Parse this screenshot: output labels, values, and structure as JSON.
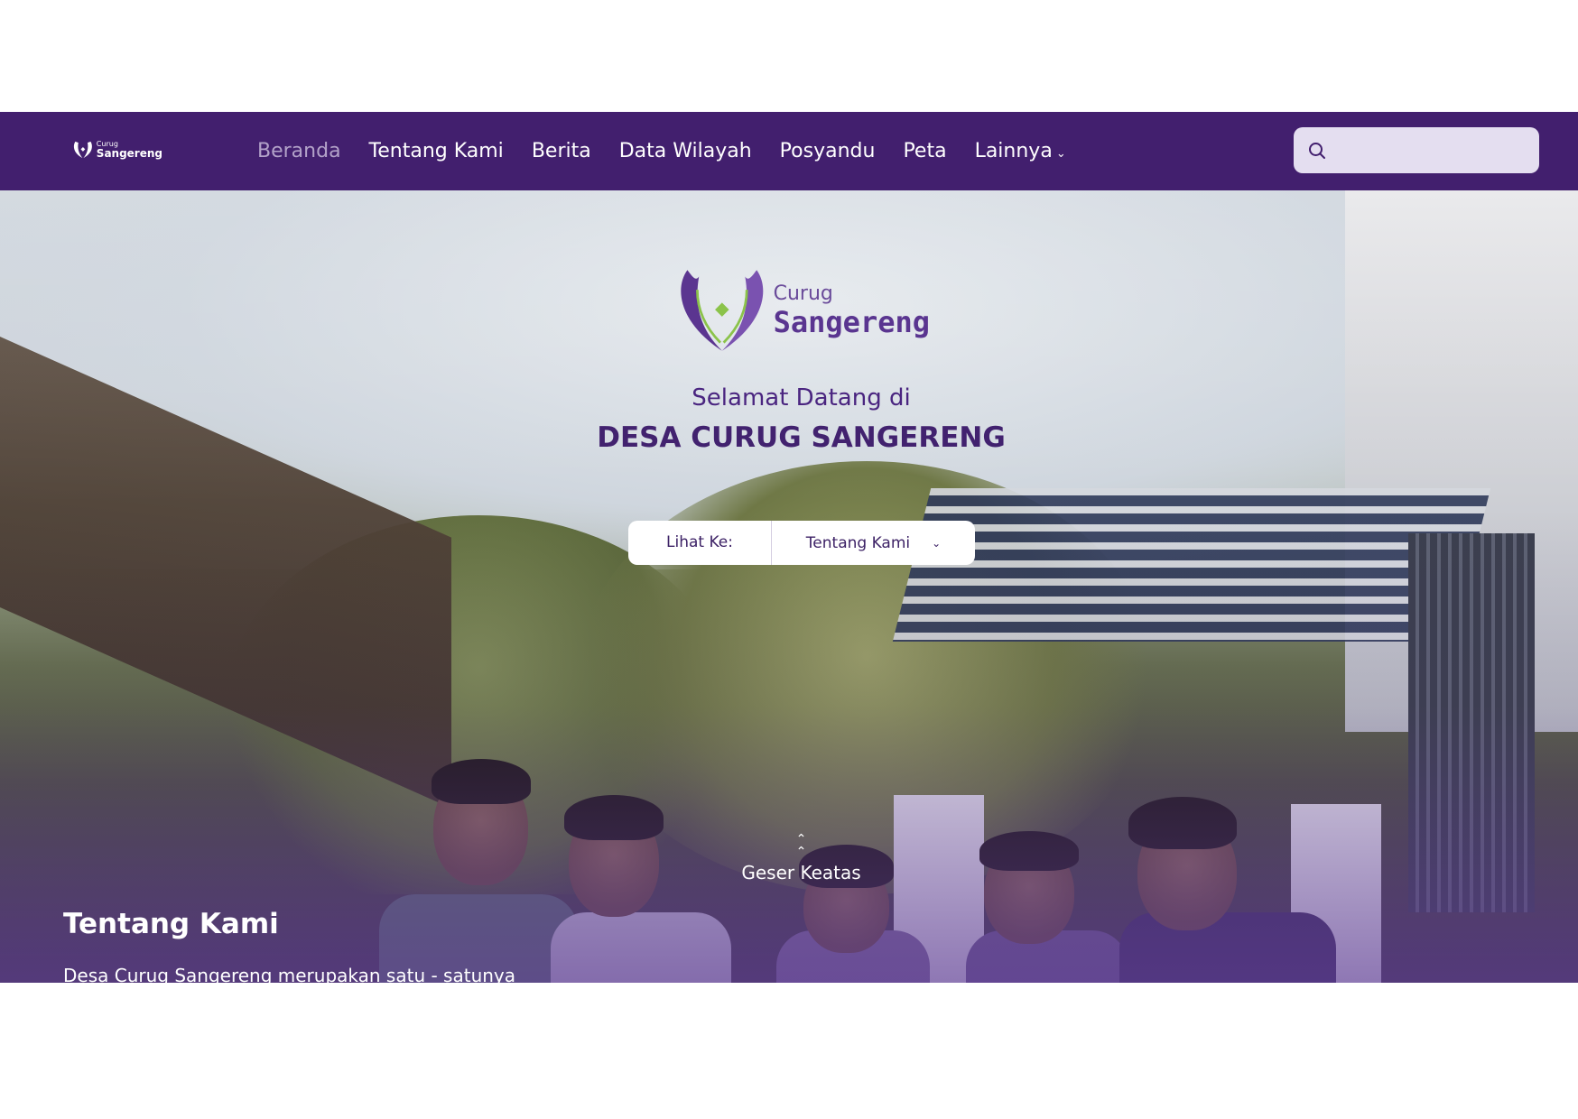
{
  "header": {
    "logo": {
      "line1": "Curug",
      "line2": "Sangereng"
    },
    "nav": [
      {
        "label": "Beranda"
      },
      {
        "label": "Tentang Kami"
      },
      {
        "label": "Berita"
      },
      {
        "label": "Data Wilayah"
      },
      {
        "label": "Posyandu"
      },
      {
        "label": "Peta"
      },
      {
        "label": "Lainnya"
      }
    ],
    "search": {
      "placeholder": "",
      "value": ""
    }
  },
  "hero": {
    "logo": {
      "line1": "Curug",
      "line2": "Sangereng"
    },
    "welcome": "Selamat Datang di",
    "title": "DESA CURUG SANGERENG",
    "goto": {
      "label": "Lihat Ke:",
      "selected": "Tentang Kami"
    },
    "scroll_label": "Geser Keatas"
  },
  "about": {
    "title": "Tentang Kami",
    "text": "Desa Curug Sangereng merupakan satu - satunya"
  },
  "colors": {
    "navbar": "#421f6e",
    "accent_purple": "#5a3590",
    "accent_green": "#8bc34a",
    "search_bg": "#e4def0"
  },
  "icons": {
    "search": "search-icon",
    "dropdown": "chevron-down-icon",
    "scroll": "double-chevron-up-icon"
  }
}
